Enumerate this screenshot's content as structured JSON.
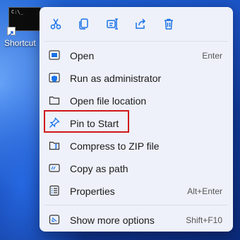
{
  "desktop": {
    "shortcut_label": "Shortcut",
    "prompt_text": "C:\\_"
  },
  "menu": {
    "toolbar": [
      "cut-icon",
      "copy-icon",
      "rename-icon",
      "share-icon",
      "delete-icon"
    ],
    "items": [
      {
        "label": "Open",
        "shortcut": "Enter",
        "icon": "open-app-icon"
      },
      {
        "label": "Run as administrator",
        "shortcut": "",
        "icon": "shield-icon"
      },
      {
        "label": "Open file location",
        "shortcut": "",
        "icon": "folder-icon"
      },
      {
        "label": "Pin to Start",
        "shortcut": "",
        "icon": "pin-icon"
      },
      {
        "label": "Compress to ZIP file",
        "shortcut": "",
        "icon": "zip-folder-icon"
      },
      {
        "label": "Copy as path",
        "shortcut": "",
        "icon": "path-icon"
      },
      {
        "label": "Properties",
        "shortcut": "Alt+Enter",
        "icon": "properties-icon"
      },
      {
        "label": "Show more options",
        "shortcut": "Shift+F10",
        "icon": "more-options-icon"
      }
    ]
  },
  "colors": {
    "accent": "#1a73e8",
    "highlight_border": "#d0161b",
    "menu_background": "#eef1f9"
  }
}
